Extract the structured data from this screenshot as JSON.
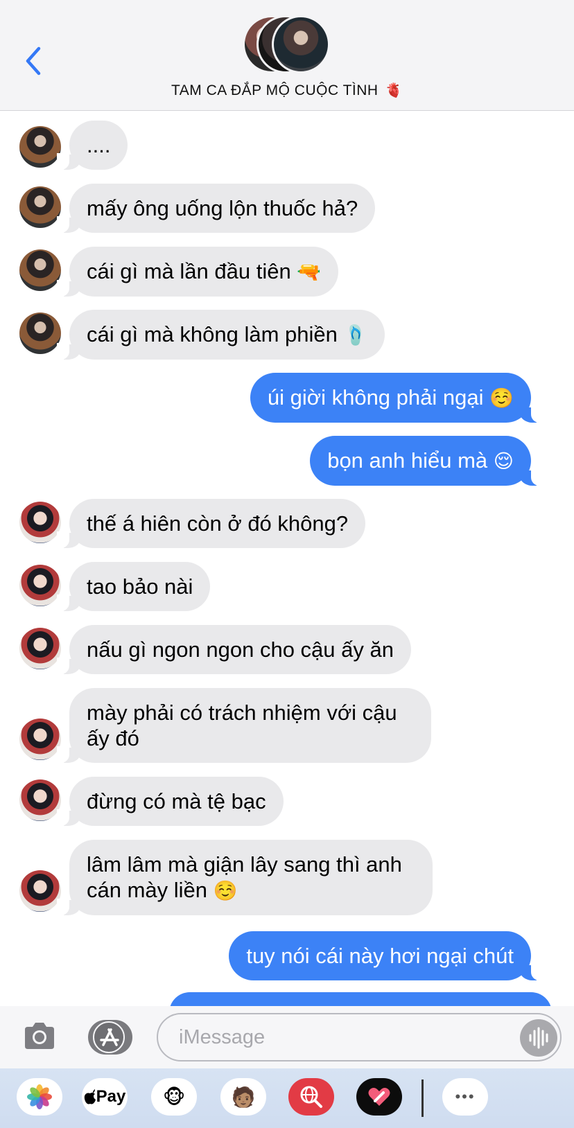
{
  "header": {
    "title": "TAM CA ĐẮP MỘ CUỘC TÌNH",
    "title_emoji": "🫀",
    "back_icon": "chevron-left-icon",
    "avatar_count": 3
  },
  "colors": {
    "outgoing_bubble": "#3c82f6",
    "incoming_bubble": "#e9e9eb",
    "accent": "#3478f6"
  },
  "messages": [
    {
      "direction": "in",
      "sender": "a",
      "text": "...."
    },
    {
      "direction": "in",
      "sender": "a",
      "text": "mấy ông uống lộn thuốc hả?"
    },
    {
      "direction": "in",
      "sender": "a",
      "text": "cái gì mà lần đầu tiên",
      "emoji": "🔫"
    },
    {
      "direction": "in",
      "sender": "a",
      "text": "cái gì mà không làm phiền",
      "emoji": "🩴"
    },
    {
      "direction": "out",
      "text": "úi giời không phải ngại",
      "emoji": "☺️"
    },
    {
      "direction": "out",
      "text": "bọn anh hiểu mà",
      "emoji": "😌"
    },
    {
      "direction": "in",
      "sender": "b",
      "text": "thế á hiên còn ở đó không?"
    },
    {
      "direction": "in",
      "sender": "b",
      "text": "tao bảo nài"
    },
    {
      "direction": "in",
      "sender": "b",
      "text": "nấu gì ngon ngon cho cậu ấy ăn"
    },
    {
      "direction": "in",
      "sender": "b",
      "text": "mày phải có trách nhiệm với cậu\nấy đó"
    },
    {
      "direction": "in",
      "sender": "b",
      "text": "đừng có mà tệ bạc"
    },
    {
      "direction": "in",
      "sender": "b",
      "text": "lâm lâm mà giận lây sang thì anh\ncán mày liền",
      "emoji": "☺️"
    },
    {
      "direction": "out",
      "text": "tuy nói cái này hơi ngại chút"
    }
  ],
  "input": {
    "placeholder": "iMessage",
    "value": ""
  },
  "drawer": {
    "apps": [
      {
        "name": "photos-app",
        "icon": "photos-icon"
      },
      {
        "name": "apple-pay-app",
        "icon": "apple-icon",
        "label": "Pay"
      },
      {
        "name": "animoji-app",
        "icon": "monkey-icon",
        "glyph": "🐵"
      },
      {
        "name": "memoji-app",
        "icon": "memoji-icon",
        "glyph": "🧑🏽"
      },
      {
        "name": "web-search-app",
        "icon": "globe-search-icon"
      },
      {
        "name": "digital-touch-app",
        "icon": "heart-touch-icon"
      },
      {
        "name": "more-apps",
        "icon": "more-icon",
        "glyph": "•••"
      }
    ]
  }
}
